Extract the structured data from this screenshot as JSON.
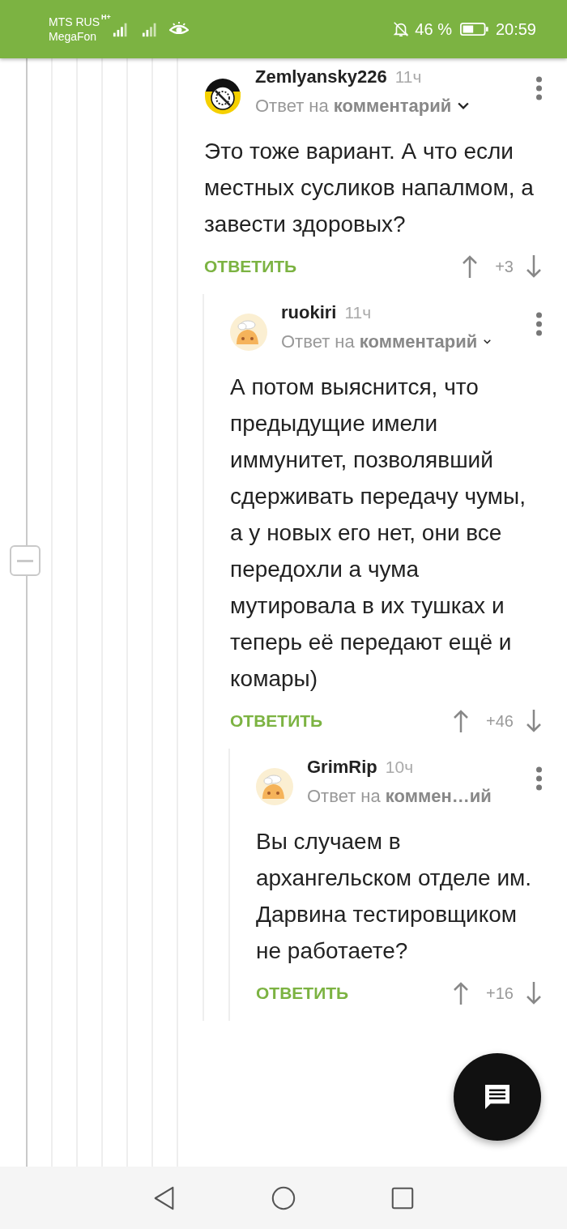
{
  "status_bar": {
    "carrier_1": "MTS RUS",
    "carrier_2": "MegaFon",
    "network": "H+",
    "battery": "46 %",
    "time": "20:59"
  },
  "comments": [
    {
      "author": "Zemlyansky226",
      "time": "11ч",
      "reply_to": "Ответ на **комментарий**",
      "expandable": true,
      "text": "Это тоже вариант. А что если местных сусликов напалмом, а завести здоровых?",
      "reply": "ОТВЕТИТЬ",
      "score": "+3",
      "children": [
        {
          "author": "ruokiri",
          "time": "11ч",
          "reply_to": "Ответ на **комментарий**",
          "expandable": true,
          "text": "А потом выяснится, что предыдущие имели иммунитет, позволявший сдерживать передачу чумы, а у новых его нет, они все передохли а чума мутировала в их тушках и теперь её передают ещё и комары)",
          "reply": "ОТВЕТИТЬ",
          "score": "+46",
          "children": [
            {
              "author": "GrimRip",
              "time": "10ч",
              "reply_to": "Ответ на **коммен…ий**",
              "expandable": false,
              "text": "Вы случаем в архангельском отделе им. Дарвина тестировщиком не работаете?",
              "reply": "ОТВЕТИТЬ",
              "score": "+16"
            }
          ]
        }
      ]
    }
  ]
}
